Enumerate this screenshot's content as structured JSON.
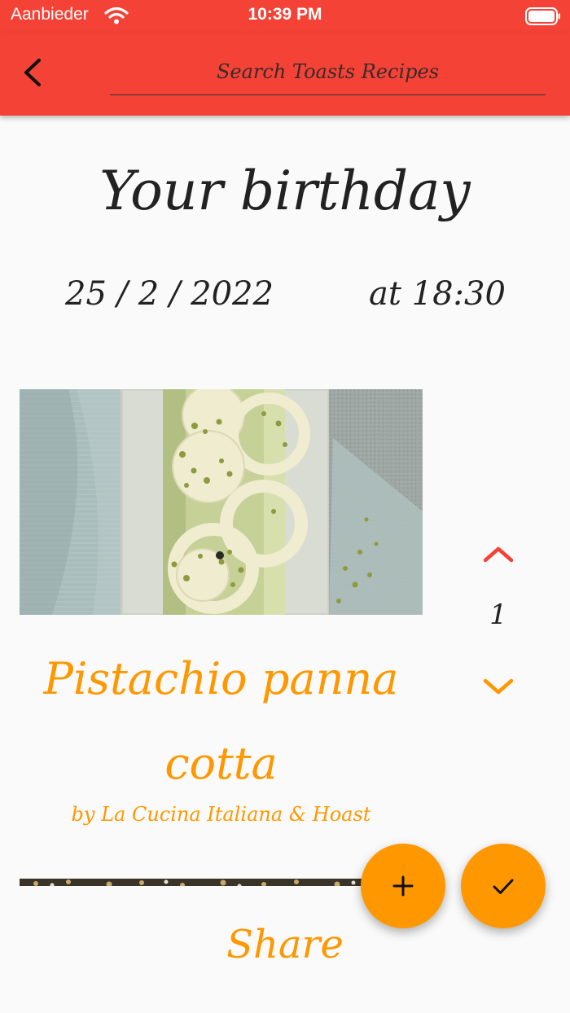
{
  "status_bar": {
    "carrier": "Aanbieder",
    "time": "10:39 PM",
    "wifi_icon": "wifi-icon",
    "battery_icon": "battery-icon"
  },
  "app_bar": {
    "background_color": "#f44336",
    "back_icon": "chevron-left-icon",
    "search": {
      "placeholder": "Search Toasts Recipes",
      "value": ""
    }
  },
  "event": {
    "title": "Your birthday",
    "date": "25 / 2 / 2022",
    "time": "at 18:30"
  },
  "recipe": {
    "title": "Pistachio panna cotta",
    "source": "by La Cucina Italiana & Hoast",
    "accent_color": "#ff9800"
  },
  "stepper": {
    "value": "1",
    "up_icon": "chevron-up-icon",
    "up_color": "#f44336",
    "down_icon": "chevron-down-icon",
    "down_color": "#ff9800"
  },
  "share": {
    "label": "Share"
  },
  "actions": {
    "add_icon": "plus-icon",
    "confirm_icon": "check-icon",
    "fab_color": "#ff9800"
  }
}
